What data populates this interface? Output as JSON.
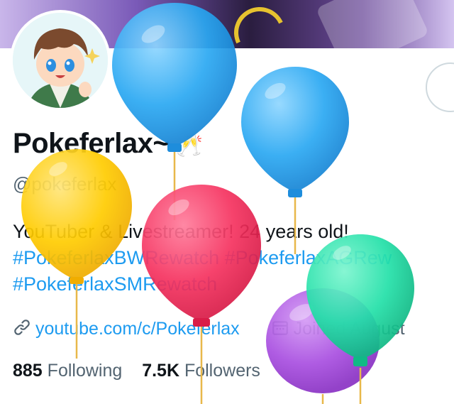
{
  "profile": {
    "display_name": "Pokeferlax~",
    "name_emoji": "🥂",
    "handle": "@pokeferlax",
    "bio_text": "YouTuber & Livestreamer! 24 years old!",
    "hashtags": [
      "#PokeferlaxBWRewatch",
      "#PokeferlaxAGRew",
      "#PokeferlaxSMRewatch"
    ],
    "website": "youtube.com/c/Pokeferlax",
    "joined": "Joined August",
    "following_count": "885",
    "following_label": "Following",
    "followers_count": "7.5K",
    "followers_label": "Followers"
  },
  "icons": {
    "link": "link-icon",
    "calendar": "calendar-icon"
  },
  "colors": {
    "accent": "#1d9bf0",
    "text": "#0f1419",
    "muted": "#536471",
    "balloon_blue": "#2aa8f2",
    "balloon_yellow": "#ffcc00",
    "balloon_pink": "#f5325f",
    "balloon_green": "#22e0a8",
    "balloon_purple": "#a84ee0"
  }
}
